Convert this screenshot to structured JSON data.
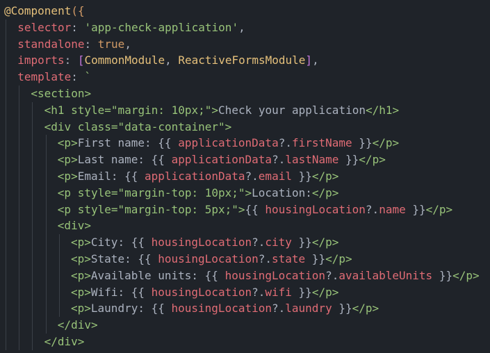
{
  "lines": [
    {
      "indent": 0,
      "tokens": [
        {
          "t": "@Component",
          "c": "decorator-name"
        },
        {
          "t": "({",
          "c": "brace-gold"
        }
      ]
    },
    {
      "indent": 1,
      "tokens": [
        {
          "t": "selector",
          "c": "prop"
        },
        {
          "t": ": ",
          "c": "punc"
        },
        {
          "t": "'app-check-application'",
          "c": "str"
        },
        {
          "t": ",",
          "c": "punc"
        }
      ]
    },
    {
      "indent": 1,
      "tokens": [
        {
          "t": "standalone",
          "c": "prop"
        },
        {
          "t": ": ",
          "c": "punc"
        },
        {
          "t": "true",
          "c": "kw"
        },
        {
          "t": ",",
          "c": "punc"
        }
      ]
    },
    {
      "indent": 1,
      "tokens": [
        {
          "t": "imports",
          "c": "prop"
        },
        {
          "t": ": ",
          "c": "punc"
        },
        {
          "t": "[",
          "c": "brace-pink"
        },
        {
          "t": "CommonModule",
          "c": "cls"
        },
        {
          "t": ", ",
          "c": "punc"
        },
        {
          "t": "ReactiveFormsModule",
          "c": "cls"
        },
        {
          "t": "]",
          "c": "brace-pink"
        },
        {
          "t": ",",
          "c": "punc"
        }
      ]
    },
    {
      "indent": 1,
      "tokens": [
        {
          "t": "template",
          "c": "prop"
        },
        {
          "t": ": ",
          "c": "punc"
        },
        {
          "t": "`",
          "c": "str"
        }
      ]
    },
    {
      "indent": 2,
      "tokens": [
        {
          "t": "<section>",
          "c": "str"
        }
      ]
    },
    {
      "indent": 3,
      "tokens": [
        {
          "t": "<h1 style=\"margin: 10px;\">",
          "c": "str"
        },
        {
          "t": "Check your application",
          "c": "text"
        },
        {
          "t": "</h1>",
          "c": "str"
        }
      ]
    },
    {
      "indent": 3,
      "tokens": [
        {
          "t": "<div class=\"data-container\">",
          "c": "str"
        }
      ]
    },
    {
      "indent": 4,
      "tokens": [
        {
          "t": "<p>",
          "c": "str"
        },
        {
          "t": "First name: {{ ",
          "c": "text"
        },
        {
          "t": "applicationData",
          "c": "interp"
        },
        {
          "t": "?.",
          "c": "text"
        },
        {
          "t": "firstName",
          "c": "interp"
        },
        {
          "t": " }}",
          "c": "text"
        },
        {
          "t": "</p>",
          "c": "str"
        }
      ]
    },
    {
      "indent": 4,
      "tokens": [
        {
          "t": "<p>",
          "c": "str"
        },
        {
          "t": "Last name: {{ ",
          "c": "text"
        },
        {
          "t": "applicationData",
          "c": "interp"
        },
        {
          "t": "?.",
          "c": "text"
        },
        {
          "t": "lastName",
          "c": "interp"
        },
        {
          "t": " }}",
          "c": "text"
        },
        {
          "t": "</p>",
          "c": "str"
        }
      ]
    },
    {
      "indent": 4,
      "tokens": [
        {
          "t": "<p>",
          "c": "str"
        },
        {
          "t": "Email: {{ ",
          "c": "text"
        },
        {
          "t": "applicationData",
          "c": "interp"
        },
        {
          "t": "?.",
          "c": "text"
        },
        {
          "t": "email",
          "c": "interp"
        },
        {
          "t": " }}",
          "c": "text"
        },
        {
          "t": "</p>",
          "c": "str"
        }
      ]
    },
    {
      "indent": 4,
      "tokens": [
        {
          "t": "<p style=\"margin-top: 10px;\">",
          "c": "str"
        },
        {
          "t": "Location:",
          "c": "text"
        },
        {
          "t": "</p>",
          "c": "str"
        }
      ]
    },
    {
      "indent": 4,
      "tokens": [
        {
          "t": "<p style=\"margin-top: 5px;\">",
          "c": "str"
        },
        {
          "t": "{{ ",
          "c": "text"
        },
        {
          "t": "housingLocation",
          "c": "interp"
        },
        {
          "t": "?.",
          "c": "text"
        },
        {
          "t": "name",
          "c": "interp"
        },
        {
          "t": " }}",
          "c": "text"
        },
        {
          "t": "</p>",
          "c": "str"
        }
      ]
    },
    {
      "indent": 4,
      "tokens": [
        {
          "t": "<div>",
          "c": "str"
        }
      ]
    },
    {
      "indent": 5,
      "tokens": [
        {
          "t": "<p>",
          "c": "str"
        },
        {
          "t": "City: {{ ",
          "c": "text"
        },
        {
          "t": "housingLocation",
          "c": "interp"
        },
        {
          "t": "?.",
          "c": "text"
        },
        {
          "t": "city",
          "c": "interp"
        },
        {
          "t": " }}",
          "c": "text"
        },
        {
          "t": "</p>",
          "c": "str"
        }
      ]
    },
    {
      "indent": 5,
      "tokens": [
        {
          "t": "<p>",
          "c": "str"
        },
        {
          "t": "State: {{ ",
          "c": "text"
        },
        {
          "t": "housingLocation",
          "c": "interp"
        },
        {
          "t": "?.",
          "c": "text"
        },
        {
          "t": "state",
          "c": "interp"
        },
        {
          "t": " }}",
          "c": "text"
        },
        {
          "t": "</p>",
          "c": "str"
        }
      ]
    },
    {
      "indent": 5,
      "tokens": [
        {
          "t": "<p>",
          "c": "str"
        },
        {
          "t": "Available units: {{ ",
          "c": "text"
        },
        {
          "t": "housingLocation",
          "c": "interp"
        },
        {
          "t": "?.",
          "c": "text"
        },
        {
          "t": "availableUnits",
          "c": "interp"
        },
        {
          "t": " }}",
          "c": "text"
        },
        {
          "t": "</p>",
          "c": "str"
        }
      ]
    },
    {
      "indent": 5,
      "tokens": [
        {
          "t": "<p>",
          "c": "str"
        },
        {
          "t": "Wifi: {{ ",
          "c": "text"
        },
        {
          "t": "housingLocation",
          "c": "interp"
        },
        {
          "t": "?.",
          "c": "text"
        },
        {
          "t": "wifi",
          "c": "interp"
        },
        {
          "t": " }}",
          "c": "text"
        },
        {
          "t": "</p>",
          "c": "str"
        }
      ]
    },
    {
      "indent": 5,
      "tokens": [
        {
          "t": "<p>",
          "c": "str"
        },
        {
          "t": "Laundry: {{ ",
          "c": "text"
        },
        {
          "t": "housingLocation",
          "c": "interp"
        },
        {
          "t": "?.",
          "c": "text"
        },
        {
          "t": "laundry",
          "c": "interp"
        },
        {
          "t": " }}",
          "c": "text"
        },
        {
          "t": "</p>",
          "c": "str"
        }
      ]
    },
    {
      "indent": 4,
      "tokens": [
        {
          "t": "</div>",
          "c": "str"
        }
      ]
    },
    {
      "indent": 3,
      "tokens": [
        {
          "t": "</div>",
          "c": "str"
        }
      ]
    }
  ],
  "colors": {
    "background": "#1f2329",
    "text": "#abb2bf",
    "property": "#e06c75",
    "string": "#98c379",
    "keyword": "#d19a66",
    "class": "#e5c07b",
    "indent_guide": "#3b4048"
  }
}
